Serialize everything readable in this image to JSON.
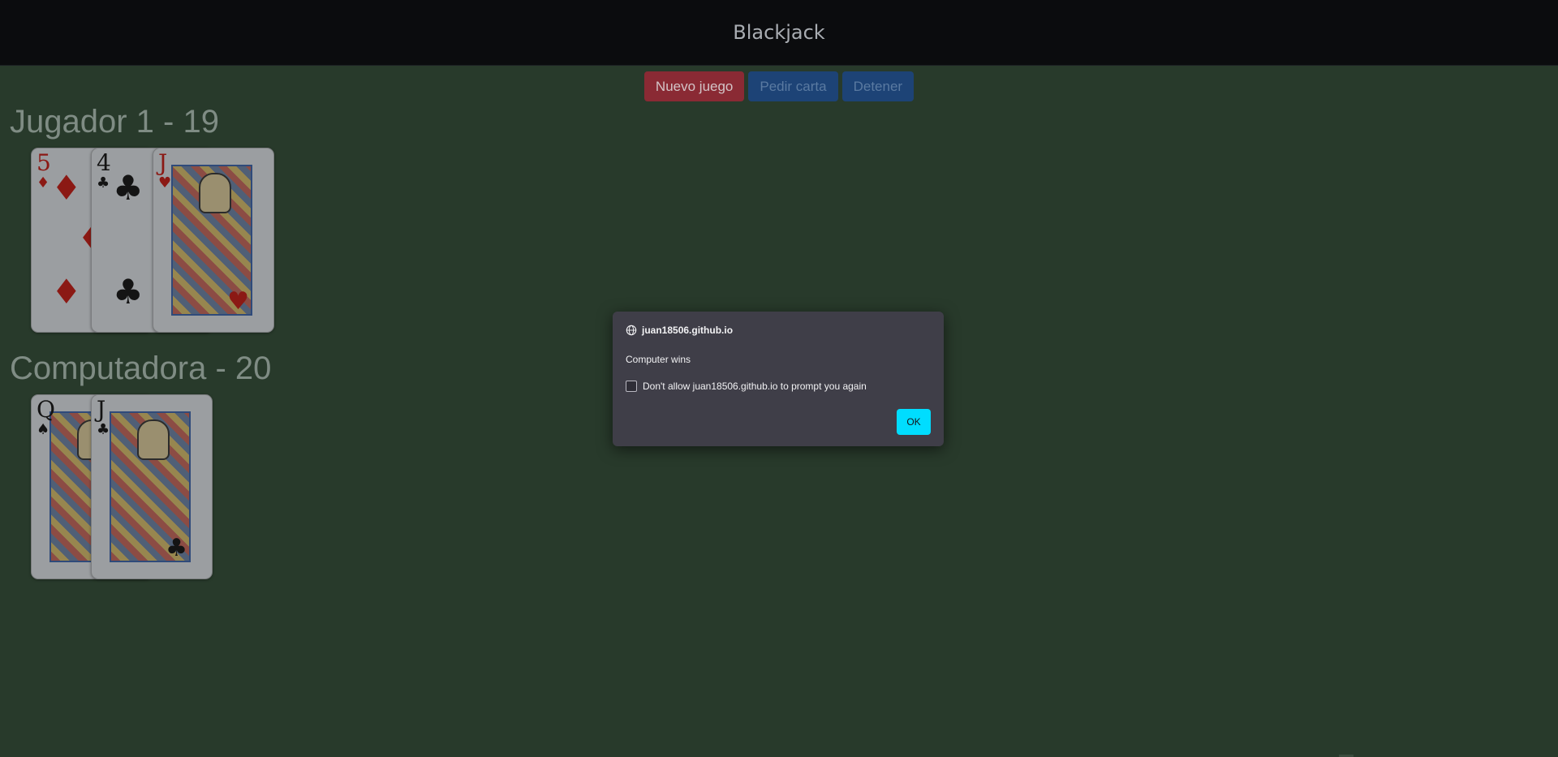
{
  "navbar": {
    "title": "Blackjack"
  },
  "controls": {
    "new_game": "Nuevo juego",
    "hit": "Pedir carta",
    "stand": "Detener"
  },
  "players": [
    {
      "title": "Jugador 1 - 19",
      "cards": [
        {
          "rank": "5",
          "suit": "♦",
          "color": "red"
        },
        {
          "rank": "4",
          "suit": "♣",
          "color": "black"
        },
        {
          "rank": "J",
          "suit": "♥",
          "color": "red"
        }
      ]
    },
    {
      "title": "Computadora - 20",
      "cards": [
        {
          "rank": "Q",
          "suit": "♠",
          "color": "black"
        },
        {
          "rank": "J",
          "suit": "♣",
          "color": "black"
        }
      ]
    }
  ],
  "dialog": {
    "origin": "juan18506.github.io",
    "message": "Computer wins",
    "checkbox_label": "Don't allow juan18506.github.io to prompt you again",
    "ok_label": "OK"
  },
  "colors": {
    "table_felt": "#283a2b",
    "navbar": "#0b0c0e",
    "danger_button": "#8a2a34",
    "primary_button": "#1d4376",
    "dialog_bg": "#3f3e48",
    "ok_button": "#00ddff"
  },
  "icons": {
    "dialog_origin": "globe-icon"
  }
}
